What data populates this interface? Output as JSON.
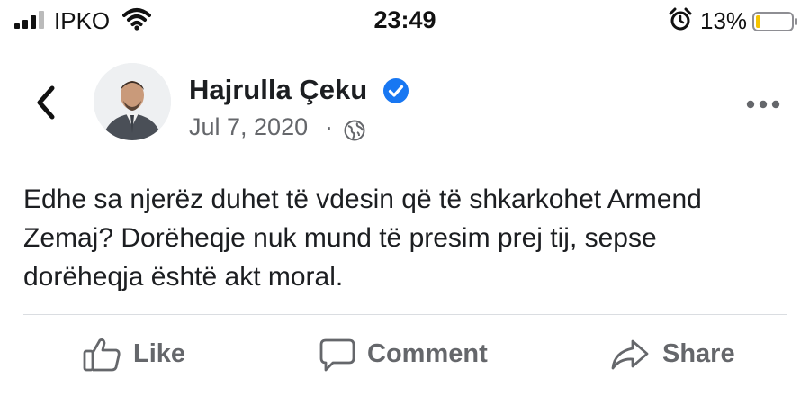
{
  "status_bar": {
    "carrier": "IPKO",
    "time": "23:49",
    "battery_percent": "13%",
    "battery_level": 0.13,
    "battery_color": "#f5c400"
  },
  "post": {
    "author": "Hajrulla Çeku",
    "verified": true,
    "date": "Jul 7, 2020",
    "separator": "·",
    "audience_icon": "globe-icon",
    "text_lines": [
      "Edhe sa njerëz duhet të vdesin që të shkarkohet Armend",
      "Zemaj? Dorëheqje nuk mund të presim prej tij, sepse",
      "dorëheqja është akt moral."
    ]
  },
  "actions": {
    "like": "Like",
    "comment": "Comment",
    "share": "Share"
  },
  "colors": {
    "verified_blue": "#1877f2",
    "secondary_text": "#65676b",
    "divider": "#dadde1"
  }
}
